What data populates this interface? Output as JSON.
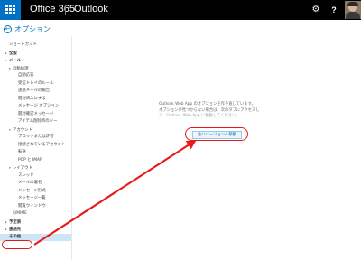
{
  "topbar": {
    "brand": "Office 365",
    "app": "Outlook",
    "gear_glyph": "⚙",
    "help_glyph": "?",
    "accent": "#0072c6"
  },
  "options": {
    "title": "オプション"
  },
  "sidebar": {
    "items": [
      {
        "label": "ショートカット",
        "level": 0,
        "section": false,
        "arrow": ""
      },
      {
        "label": "全般",
        "level": 0,
        "section": true,
        "arrow": "▸"
      },
      {
        "label": "メール",
        "level": 0,
        "section": true,
        "arrow": "▾"
      },
      {
        "label": "自動処理",
        "level": 1,
        "section": false,
        "arrow": "▾"
      },
      {
        "label": "自動応答",
        "level": 2,
        "section": false,
        "arrow": ""
      },
      {
        "label": "受信トレイのルール",
        "level": 2,
        "section": false,
        "arrow": ""
      },
      {
        "label": "迷惑メールの報告",
        "level": 2,
        "section": false,
        "arrow": ""
      },
      {
        "label": "開封済みにする",
        "level": 2,
        "section": false,
        "arrow": ""
      },
      {
        "label": "メッセージ オプション",
        "level": 2,
        "section": false,
        "arrow": ""
      },
      {
        "label": "開封確認メッセージ",
        "level": 2,
        "section": false,
        "arrow": ""
      },
      {
        "label": "アイテム削除時のジー",
        "level": 2,
        "section": false,
        "arrow": ""
      },
      {
        "label": "アカウント",
        "level": 1,
        "section": false,
        "arrow": "▾"
      },
      {
        "label": "ブロックまたは許可",
        "level": 2,
        "section": false,
        "arrow": ""
      },
      {
        "label": "接続されているアカウント",
        "level": 2,
        "section": false,
        "arrow": ""
      },
      {
        "label": "転送",
        "level": 2,
        "section": false,
        "arrow": ""
      },
      {
        "label": "POP と IMAP",
        "level": 2,
        "section": false,
        "arrow": ""
      },
      {
        "label": "レイアウト",
        "level": 1,
        "section": false,
        "arrow": "▾"
      },
      {
        "label": "スレッド",
        "level": 2,
        "section": false,
        "arrow": ""
      },
      {
        "label": "メールの署名",
        "level": 2,
        "section": false,
        "arrow": ""
      },
      {
        "label": "メッセージ形式",
        "level": 2,
        "section": false,
        "arrow": ""
      },
      {
        "label": "メッセージ一覧",
        "level": 2,
        "section": false,
        "arrow": ""
      },
      {
        "label": "閲覧ウィンドウ",
        "level": 2,
        "section": false,
        "arrow": ""
      },
      {
        "label": "S/MIME",
        "level": 1,
        "section": false,
        "arrow": ""
      },
      {
        "label": "予定表",
        "level": 0,
        "section": true,
        "arrow": "▸"
      },
      {
        "label": "連絡先",
        "level": 0,
        "section": true,
        "arrow": "▸"
      },
      {
        "label": "その他",
        "level": 0,
        "section": true,
        "arrow": "",
        "selected": true
      }
    ]
  },
  "message": {
    "line1": "Outlook Web App のオプションを作り直しています。",
    "line2": "オプションが見つからない場合は、次のタブにアクセスし",
    "line3": "て、Outlook Web App に移動してください。",
    "button_label": "古いバージョンへ移動"
  },
  "annotation_color": "#e81a1a"
}
